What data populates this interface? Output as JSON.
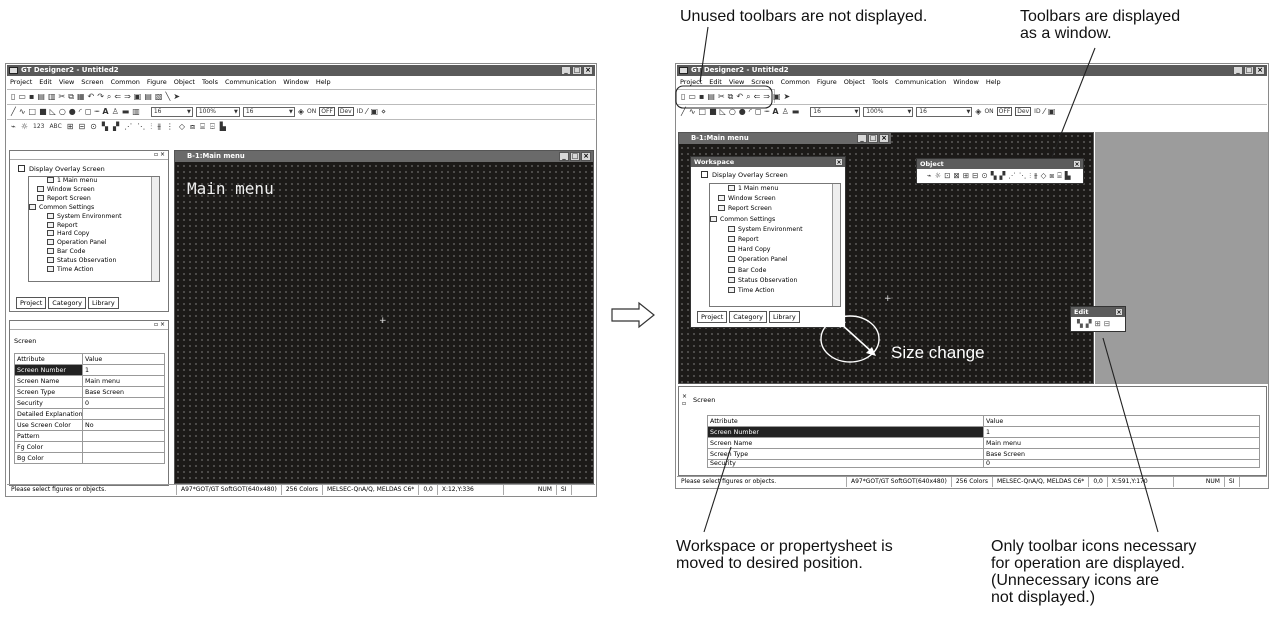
{
  "app": {
    "window_title": "GT Designer2 - Untitled2",
    "menu": [
      "Project",
      "Edit",
      "View",
      "Screen",
      "Common",
      "Figure",
      "Object",
      "Tools",
      "Communication",
      "Window",
      "Help"
    ],
    "toolbar_icons": [
      "new-icon",
      "open-icon",
      "save-icon",
      "print-icon",
      "cut-icon",
      "copy-icon",
      "paste-icon",
      "undo-icon",
      "redo-icon",
      "zoom-icon",
      "prev-screen-icon",
      "next-screen-icon",
      "screen-list-icon",
      "select-icon"
    ],
    "figure_tools": [
      "line-icon",
      "polyline-icon",
      "rectangle-icon",
      "filled-rectangle-icon",
      "polygon-icon",
      "circle-icon",
      "filled-circle-icon",
      "arc-icon",
      "sector-icon",
      "scale-icon",
      "text-icon",
      "paint-icon",
      "image-icon"
    ],
    "font_size_value": "16",
    "zoom_value": "100%",
    "grid_value": "16",
    "on_label": "ON",
    "off_label": "OFF",
    "dev_label": "Dev",
    "id_label": "ID",
    "overlay_checkbox_label": "Display Overlay Screen",
    "tree_items": [
      "1 Main menu",
      "Window Screen",
      "Report Screen",
      "Common Settings",
      "System Environment",
      "Report",
      "Hard Copy",
      "Operation Panel",
      "Bar Code",
      "Status Observation",
      "Time Action"
    ],
    "tabs": [
      "Project",
      "Category",
      "Library"
    ],
    "property_header": "Screen",
    "property_columns": [
      "Attribute",
      "Value"
    ],
    "properties": [
      {
        "attr": "Screen Number",
        "value": "1"
      },
      {
        "attr": "Screen Name",
        "value": "Main menu"
      },
      {
        "attr": "Screen Type",
        "value": "Base Screen"
      },
      {
        "attr": "Security",
        "value": "0"
      },
      {
        "attr": "Detailed Explanation",
        "value": ""
      },
      {
        "attr": "Use Screen Color",
        "value": "No"
      },
      {
        "attr": "Pattern",
        "value": ""
      },
      {
        "attr": "Fg Color",
        "value": ""
      },
      {
        "attr": "Bg Color",
        "value": ""
      }
    ],
    "canvas_title": "B-1:Main menu",
    "canvas_text": "Main menu",
    "status_left": "Please select figures or objects.",
    "status_got": "A97*GOT/GT SoftGOT(640x480)",
    "status_colors": "256 Colors",
    "status_plc": "MELSEC-QnA/Q, MELDAS C6*",
    "status_origin": "0,0",
    "status_cursor_left": "X:12,Y:336",
    "status_cursor_right": "X:591,Y:170",
    "status_num": "NUM",
    "status_extra": "SI",
    "workspace_title": "Workspace",
    "object_title": "Object",
    "edit_title": "Edit"
  },
  "annotations": {
    "unused_toolbars": "Unused toolbars are not displayed.",
    "toolbars_window": [
      "Toolbars are displayed",
      "as a window."
    ],
    "size_change": "Size change",
    "workspace_moved": [
      "Workspace or propertysheet is",
      "moved to desired position."
    ],
    "only_icons": [
      "Only toolbar icons necessary",
      "for operation are displayed.",
      "(Unnecessary icons are",
      "not displayed.)"
    ]
  },
  "colors": {
    "canvas_bg": "#1c1a18",
    "title_bg": "#5a5a5a"
  }
}
